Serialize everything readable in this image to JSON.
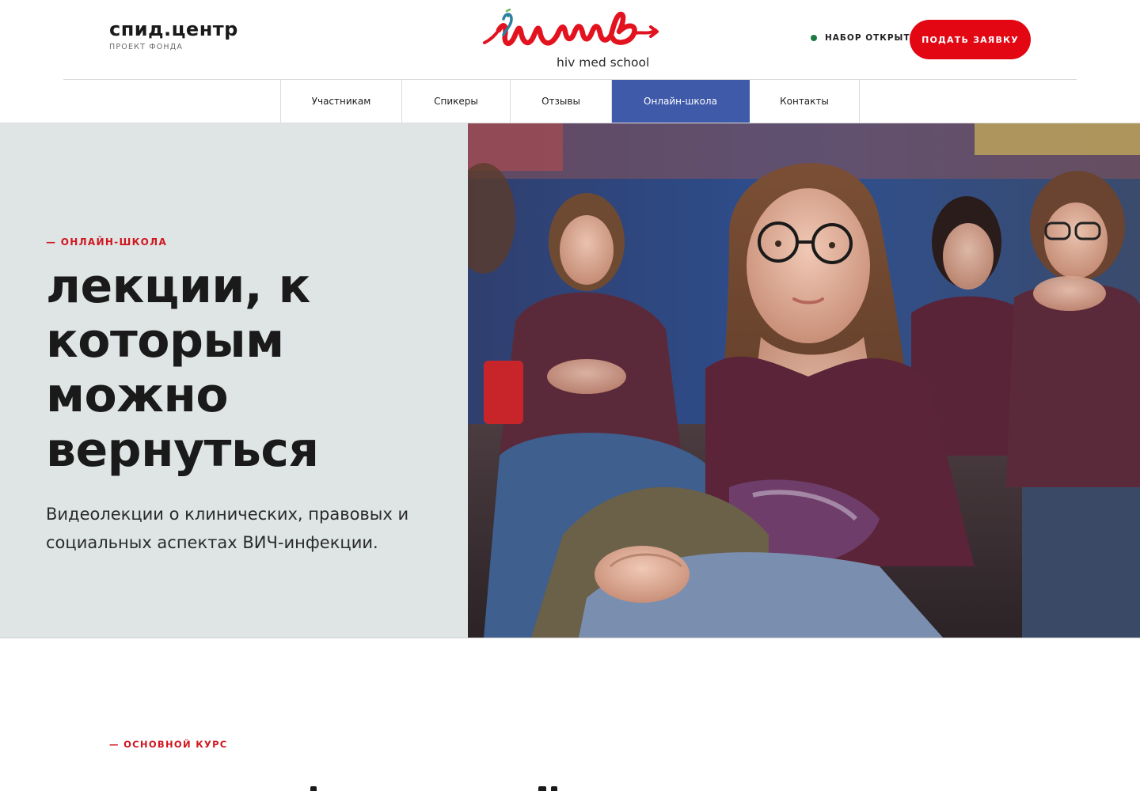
{
  "header": {
    "brand_name": "спид.центр",
    "brand_sub": "ПРОЕКТ ФОНДА",
    "logo_script": "шмв",
    "logo_caption": "hiv med school",
    "status_text": "НАБОР ОТКРЫТ",
    "apply_label": "ПОДАТЬ ЗАЯВКУ"
  },
  "nav": {
    "items": [
      {
        "label": "Участникам"
      },
      {
        "label": "Спикеры"
      },
      {
        "label": "Отзывы"
      },
      {
        "label": "Онлайн-школа",
        "active": true
      },
      {
        "label": "Контакты"
      }
    ]
  },
  "hero": {
    "eyebrow": "— ОНЛАЙН-ШКОЛА",
    "title": "лекции, к которым можно вернуться",
    "description": "Видеолекции о клинических, правовых и социальных аспектах ВИЧ-инфекции."
  },
  "section": {
    "eyebrow": "— ОСНОВНОЙ КУРС"
  },
  "colors": {
    "accent_red": "#e30613",
    "nav_active": "#3f5aa9",
    "hero_panel": "#dfe5e5",
    "status_green": "#1e7a43"
  },
  "icons": {
    "status": "status-dot-icon",
    "logo": "hiv-med-school-logo"
  }
}
